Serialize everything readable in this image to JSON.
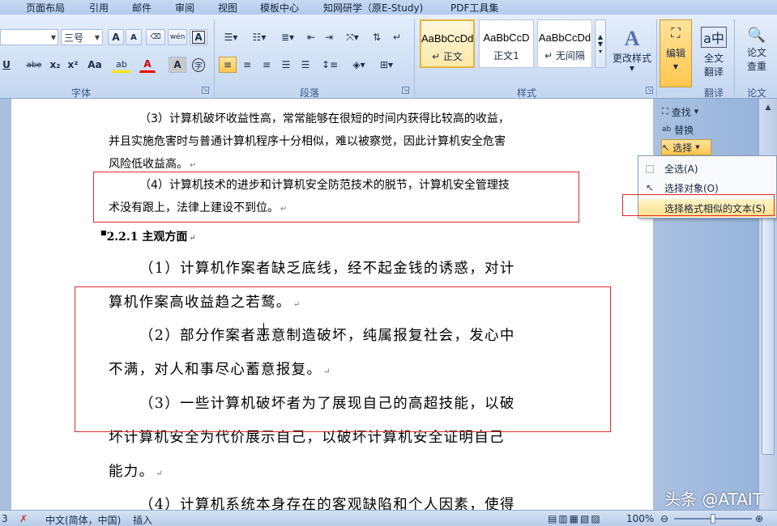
{
  "menu": {
    "tabs": [
      "页面布局",
      "引用",
      "邮件",
      "审阅",
      "视图",
      "模板中心",
      "知网研学（原E-Study)",
      "PDF工具集"
    ]
  },
  "ribbon": {
    "font": {
      "name_value": "",
      "size_value": "三号",
      "grow": "A",
      "shrink": "A",
      "phonetic": "wén",
      "border_char": "A",
      "underline": "U",
      "strike": "abe",
      "subscript": "x₂",
      "superscript": "x²",
      "change_case": "Aa",
      "highlight": "ab",
      "font_color": "A",
      "shading_char": "A",
      "enclose_char": "字",
      "group_label": "字体"
    },
    "paragraph": {
      "group_label": "段落"
    },
    "styles": {
      "items": [
        {
          "sample": "AaBbCcDd",
          "name": "↵ 正文"
        },
        {
          "sample": "AaBbCcD",
          "name": "正文1"
        },
        {
          "sample": "AaBbCcDd",
          "name": "↵ 无间隔"
        }
      ],
      "change_styles": "更改样式",
      "group_label": "样式"
    },
    "editing": {
      "label": "编辑"
    },
    "translate": {
      "label1": "全文",
      "label2": "翻译",
      "group_label": "翻译"
    },
    "paper": {
      "label1": "论文",
      "label2": "查重",
      "group_label": "论文"
    }
  },
  "document": {
    "para1_lines": [
      "（3）计算机破坏收益性高，常常能够在很短的时间内获得比较高的收益，",
      "并且实施危害时与普通计算机程序十分相似，难以被察觉，因此计算机安全危害",
      "风险低收益高。"
    ],
    "para2_lines": [
      "（4）计算机技术的进步和计算机安全防范技术的脱节，计算机安全管理技",
      "术没有跟上，法律上建设不到位。"
    ],
    "heading": "2.2.1 主观方面",
    "big_lines": [
      "（1）计算机作案者缺乏底线，经不起金钱的诱惑，对计",
      "算机作案高收益趋之若鹜。",
      "（2）部分作案者恶意制造破坏，纯属报复社会，发心中",
      "不满，对人和事尽心蓄意报复。",
      "（3）一些计算机破坏者为了展现自己的高超技能，以破",
      "坏计算机安全为代价展示自己，以破坏计算机安全证明自己",
      "能力。",
      "（4）计算机系统本身存在的客观缺陷和个人因素，使得"
    ],
    "return_mark": "↵"
  },
  "editing_pane": {
    "find": "查找",
    "replace": "替换",
    "select": "选择"
  },
  "select_menu": {
    "items": [
      {
        "label": "全选(A)",
        "icon": "select-all-icon"
      },
      {
        "label": "选择对象(O)",
        "icon": "select-object-icon"
      },
      {
        "label": "选择格式相似的文本(S)",
        "icon": ""
      }
    ]
  },
  "statusbar": {
    "page_num": "3",
    "language": "中文(简体，中国)",
    "mode": "插入",
    "zoom": "100%"
  },
  "watermark": "头条 @ATAIT",
  "colors": {
    "red_box": "#e02a2a",
    "ribbon_bg": "#d5e3f6",
    "highlight": "#ffe08a"
  }
}
